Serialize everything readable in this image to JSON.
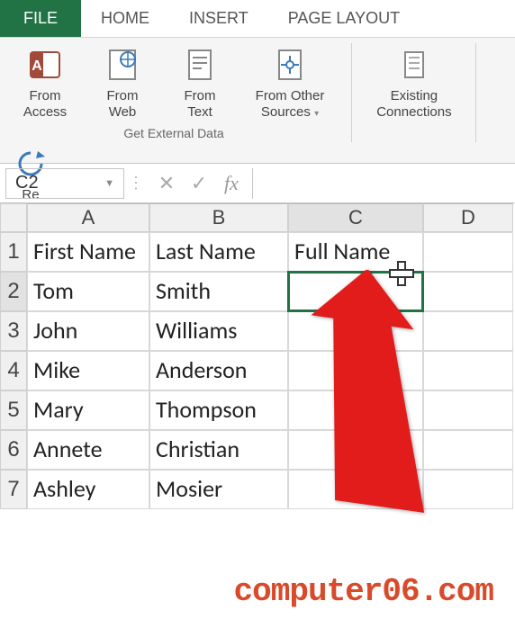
{
  "ribbon": {
    "tabs": {
      "file": "FILE",
      "home": "HOME",
      "insert": "INSERT",
      "pagelayout": "PAGE LAYOUT"
    },
    "buttons": {
      "fromAccess": "From\nAccess",
      "fromWeb": "From\nWeb",
      "fromText": "From\nText",
      "fromOther": "From Other\nSources",
      "existing": "Existing\nConnections",
      "refresh": "Re\nA"
    },
    "groupLabel": "Get External Data"
  },
  "nameBox": "C2",
  "formula": "",
  "columns": [
    "A",
    "B",
    "C",
    "D"
  ],
  "rows": [
    "1",
    "2",
    "3",
    "4",
    "5",
    "6",
    "7"
  ],
  "sheet": [
    {
      "a": "First Name",
      "b": "Last Name",
      "c": "Full Name",
      "d": ""
    },
    {
      "a": "Tom",
      "b": "Smith",
      "c": "",
      "d": ""
    },
    {
      "a": "John",
      "b": "Williams",
      "c": "",
      "d": ""
    },
    {
      "a": "Mike",
      "b": "Anderson",
      "c": "",
      "d": ""
    },
    {
      "a": "Mary",
      "b": "Thompson",
      "c": "",
      "d": ""
    },
    {
      "a": "Annete",
      "b": "Christian",
      "c": "",
      "d": ""
    },
    {
      "a": "Ashley",
      "b": "Mosier",
      "c": "",
      "d": ""
    }
  ],
  "selectedCell": "C2",
  "watermark": "computer06.com"
}
